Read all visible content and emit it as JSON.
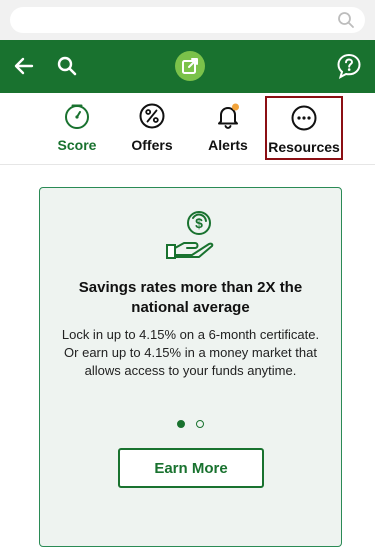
{
  "tabs": [
    {
      "label": "Score",
      "icon": "gauge-icon",
      "active": true
    },
    {
      "label": "Offers",
      "icon": "percent-icon"
    },
    {
      "label": "Alerts",
      "icon": "bell-icon",
      "badge": true
    },
    {
      "label": "Resources",
      "icon": "more-icon",
      "highlighted": true
    }
  ],
  "promo": {
    "title": "Savings rates more than 2X the national average",
    "body": "Lock in up to 4.15% on a 6-month certificate. Or earn up to 4.15% in a money market that allows access to your funds anytime.",
    "cta_label": "Earn More",
    "page_index": 1,
    "page_count": 2
  },
  "colors": {
    "brand_green": "#19722f",
    "accent_green": "#7bc24a",
    "alert_badge": "#f2a33a",
    "highlight_border": "#8b0f14"
  }
}
